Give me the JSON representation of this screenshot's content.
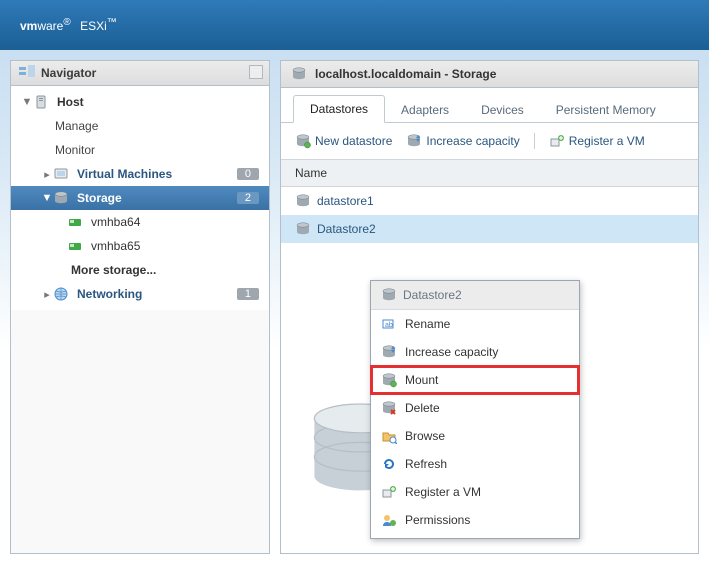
{
  "brand": {
    "name1": "vm",
    "name2": "ware",
    "reg": "®",
    "prod": "ESXi",
    "tm": "™"
  },
  "navigator": {
    "title": "Navigator",
    "host": "Host",
    "manage": "Manage",
    "monitor": "Monitor",
    "vms": "Virtual Machines",
    "vms_badge": "0",
    "storage": "Storage",
    "storage_badge": "2",
    "hba1": "vmhba64",
    "hba2": "vmhba65",
    "more": "More storage...",
    "networking": "Networking",
    "net_badge": "1"
  },
  "main": {
    "title": "localhost.localdomain - Storage",
    "tabs": {
      "datastores": "Datastores",
      "adapters": "Adapters",
      "devices": "Devices",
      "pmem": "Persistent Memory"
    },
    "toolbar": {
      "new": "New datastore",
      "increase": "Increase capacity",
      "register": "Register a VM"
    },
    "grid": {
      "col_name": "Name",
      "row1": "datastore1",
      "row2": "Datastore2"
    }
  },
  "context": {
    "title": "Datastore2",
    "rename": "Rename",
    "increase": "Increase capacity",
    "mount": "Mount",
    "delete": "Delete",
    "browse": "Browse",
    "refresh": "Refresh",
    "register": "Register a VM",
    "permissions": "Permissions"
  }
}
